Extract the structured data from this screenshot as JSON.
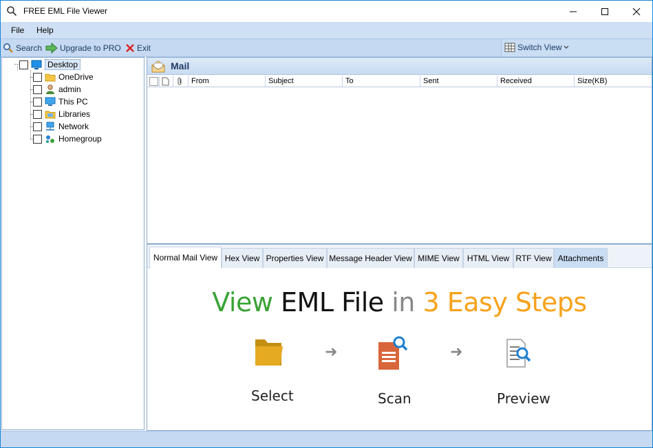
{
  "window": {
    "title": "FREE EML File Viewer"
  },
  "menu": {
    "file": "File",
    "help": "Help"
  },
  "toolbar": {
    "search": "Search",
    "upgrade": "Upgrade to PRO",
    "exit": "Exit",
    "switch_view": "Switch View"
  },
  "tree": {
    "root": "Desktop",
    "items": [
      {
        "label": "OneDrive",
        "icon": "folder-icon"
      },
      {
        "label": "admin",
        "icon": "user-icon"
      },
      {
        "label": "This PC",
        "icon": "computer-icon"
      },
      {
        "label": "Libraries",
        "icon": "libraries-icon"
      },
      {
        "label": "Network",
        "icon": "network-icon"
      },
      {
        "label": "Homegroup",
        "icon": "homegroup-icon"
      }
    ]
  },
  "mail": {
    "title": "Mail",
    "columns": [
      "From",
      "Subject",
      "To",
      "Sent",
      "Received",
      "Size(KB)"
    ]
  },
  "tabs": [
    "Normal Mail View",
    "Hex View",
    "Properties View",
    "Message Header View",
    "MIME View",
    "HTML View",
    "RTF View",
    "Attachments"
  ],
  "hero": {
    "part1": "View",
    "part2": " EML File",
    "part3": " in",
    "part4": " 3 Easy Steps",
    "steps": [
      "Select",
      "Scan",
      "Preview"
    ]
  },
  "colors": {
    "green": "#3aa335",
    "gray": "#888888",
    "orange": "#f7a21b",
    "accent": "#1883d7"
  }
}
